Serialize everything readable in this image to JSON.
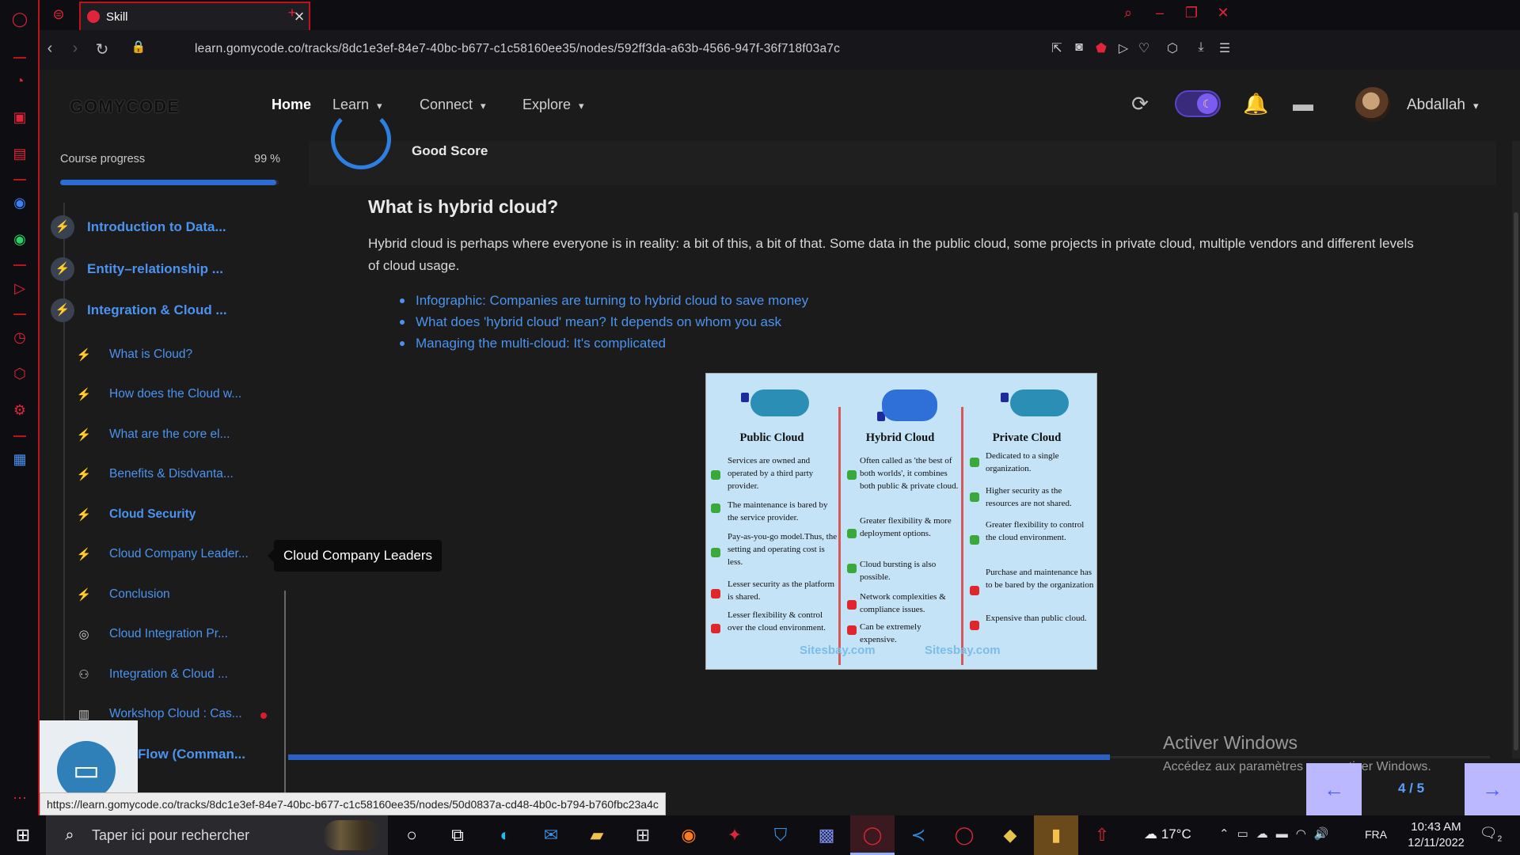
{
  "browser": {
    "tab_title": "Skill",
    "url": "learn.gomycode.co/tracks/8dc1e3ef-84e7-40bc-b677-c1c58160ee35/nodes/592ff3da-a63b-4566-947f-36f718f03a7c",
    "status_url": "https://learn.gomycode.co/tracks/8dc1e3ef-84e7-40bc-b677-c1c58160ee35/nodes/50d0837a-cd48-4b0c-b794-b760fbc23a4c"
  },
  "header": {
    "logo": "GOMYCODE",
    "nav": [
      "Home",
      "Learn",
      "Connect",
      "Explore"
    ],
    "username": "Abdallah"
  },
  "sidebar": {
    "progress_label": "Course progress",
    "progress_value": "99 %",
    "progress_fraction": 0.99,
    "chapters": [
      "Introduction to Data...",
      "Entity–relationship ...",
      "Integration & Cloud ..."
    ],
    "lessons": [
      "What is Cloud?",
      "How does the Cloud w...",
      "What are the core el...",
      "Benefits & Disdvanta...",
      "Cloud Security",
      "Cloud Company Leader...",
      "Conclusion",
      "Cloud Integration Pr...",
      "Integration & Cloud ...",
      "Workshop Cloud : Cas..."
    ],
    "partial_chapter": "Flow (Comman..."
  },
  "tooltip": "Cloud Company Leaders",
  "content": {
    "score_label": "Good Score",
    "title": "What is hybrid cloud?",
    "paragraph": "Hybrid cloud is perhaps where everyone is in reality: a bit of this, a bit of that. Some data in the public cloud, some projects in private cloud, multiple vendors and different levels of cloud usage.",
    "links": [
      "Infographic: Companies are turning to hybrid cloud to save money",
      "What does 'hybrid cloud' mean? It depends on whom you ask",
      "Managing the multi-cloud: It's complicated"
    ]
  },
  "infographic": {
    "columns": [
      {
        "title": "Public Cloud",
        "items": [
          "Services are owned and operated by a third party provider.",
          "The maintenance is bared by the service provider.",
          "Pay-as-you-go model.Thus, the setting and operating cost is less.",
          "Lesser security as the platform is shared.",
          "Lesser flexibility & control over the cloud environment."
        ]
      },
      {
        "title": "Hybrid Cloud",
        "items": [
          "Often called as 'the best of both worlds', it combines both public & private cloud.",
          "Greater flexibility & more deployment options.",
          "Cloud bursting is also possible.",
          "Network complexities & compliance issues.",
          "Can be extremely expensive."
        ]
      },
      {
        "title": "Private Cloud",
        "items": [
          "Dedicated to a single organization.",
          "Higher security as the resources are not shared.",
          "Greater flexibility to control the cloud environment.",
          "Purchase and maintenance has to be bared by the organization",
          "Expensive than public cloud."
        ]
      }
    ],
    "watermarks": [
      "Sitesbay.com",
      "Sitesbay.com"
    ]
  },
  "activation": {
    "title": "Activer Windows",
    "subtitle": "Accédez aux paramètres pour activer Windows."
  },
  "pager": {
    "text": "4 / 5",
    "prev": "←",
    "next": "→"
  },
  "taskbar": {
    "search_placeholder": "Taper ici pour rechercher",
    "weather": "17°C",
    "lang": "FRA",
    "time": "10:43 AM",
    "date": "12/11/2022",
    "notifications": "2"
  }
}
